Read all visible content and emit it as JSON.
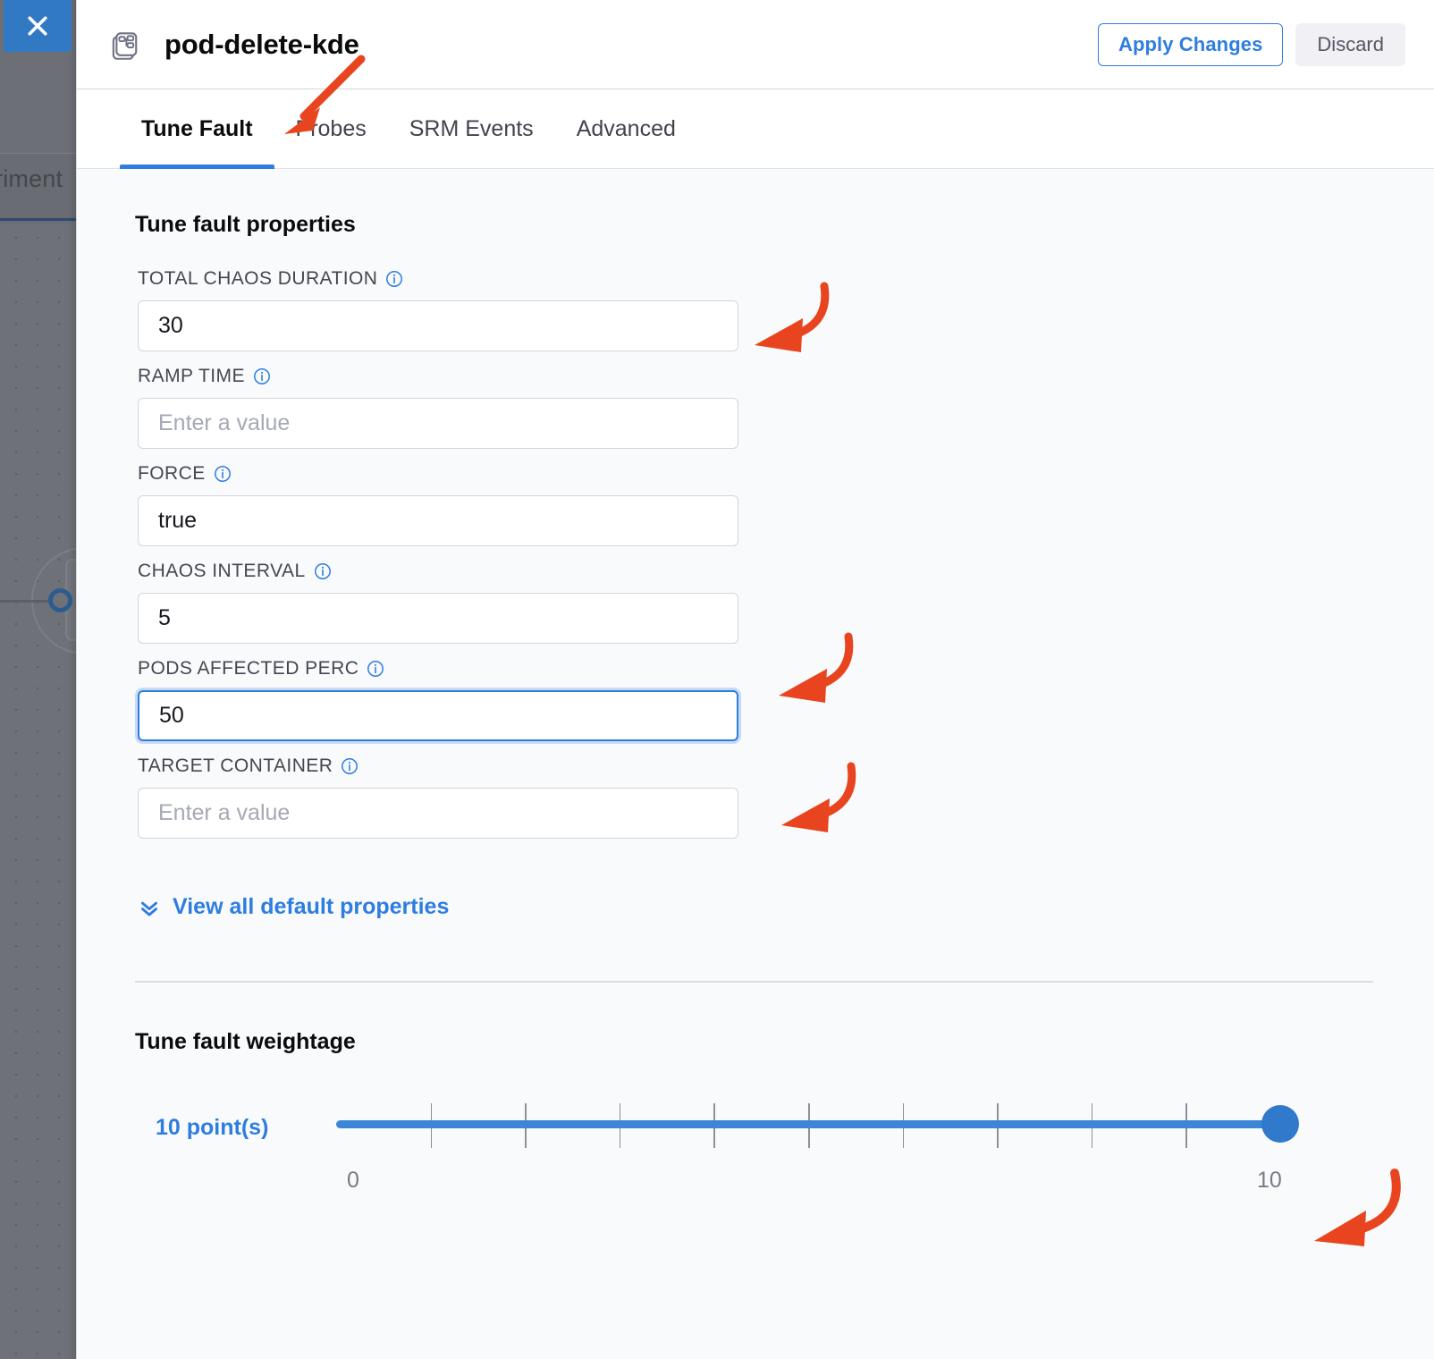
{
  "backdrop": {
    "breadcrumb_partial": "riment"
  },
  "close_button": {
    "label": "×",
    "icon": "close-icon"
  },
  "header": {
    "icon": "chaos-fault-icon",
    "title": "pod-delete-kde",
    "apply_label": "Apply Changes",
    "discard_label": "Discard",
    "accent_color": "#2e7de0"
  },
  "tabs": [
    {
      "label": "Tune Fault",
      "active": true
    },
    {
      "label": "Probes",
      "active": false
    },
    {
      "label": "SRM Events",
      "active": false
    },
    {
      "label": "Advanced",
      "active": false
    }
  ],
  "properties": {
    "section_title": "Tune fault properties",
    "fields": [
      {
        "label": "TOTAL CHAOS DURATION",
        "value": "30",
        "placeholder": "Enter a value",
        "focused": false
      },
      {
        "label": "RAMP TIME",
        "value": "",
        "placeholder": "Enter a value",
        "focused": false
      },
      {
        "label": "FORCE",
        "value": "true",
        "placeholder": "Enter a value",
        "focused": false
      },
      {
        "label": "CHAOS INTERVAL",
        "value": "5",
        "placeholder": "Enter a value",
        "focused": false
      },
      {
        "label": "PODS AFFECTED PERC",
        "value": "50",
        "placeholder": "Enter a value",
        "focused": true
      },
      {
        "label": "TARGET CONTAINER",
        "value": "",
        "placeholder": "Enter a value",
        "focused": false
      }
    ],
    "view_all_label": "View all default properties"
  },
  "weightage": {
    "title": "Tune fault weightage",
    "points_label": "10 point(s)",
    "value": 10,
    "min": 0,
    "max": 10,
    "min_label": "0",
    "max_label": "10",
    "tick_count": 9,
    "track_color": "#3b86d6",
    "thumb_color": "#3179ca"
  },
  "annotations": {
    "color": "#e8441f",
    "items": [
      {
        "name": "arrow-to-tune-fault-tab",
        "style": "straight"
      },
      {
        "name": "arrow-to-total-chaos-duration",
        "style": "curved"
      },
      {
        "name": "arrow-to-chaos-interval",
        "style": "curved"
      },
      {
        "name": "arrow-to-pods-affected-perc",
        "style": "curved"
      },
      {
        "name": "arrow-to-weightage-slider",
        "style": "curved"
      }
    ]
  }
}
